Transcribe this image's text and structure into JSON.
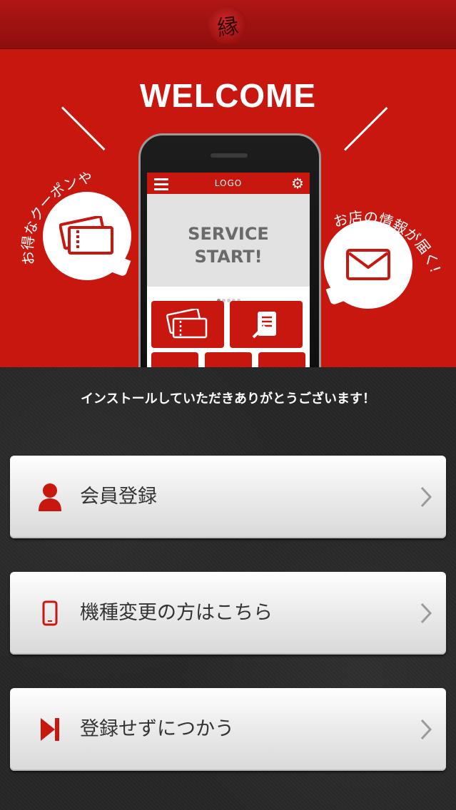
{
  "header": {
    "logo_char": "縁",
    "logo_label": "logo-seal"
  },
  "hero": {
    "title": "WELCOME",
    "left_bubble_caption": "お得なクーポンや",
    "right_bubble_caption": "お店の情報が届く!",
    "phone": {
      "logo": "LOGO",
      "service_text": "SERVICE\nSTART!"
    }
  },
  "thanks": "インストールしていただきありがとうございます！",
  "menu": {
    "register": {
      "label": "会員登録",
      "icon": "person-icon"
    },
    "device_change": {
      "label": "機種変更の方はこちら",
      "icon": "smartphone-icon"
    },
    "skip": {
      "label": "登録せずにつかう",
      "icon": "skip-icon"
    }
  },
  "colors": {
    "brand_red": "#c8170f",
    "icon_red": "#c8170f",
    "bg_dark": "#262626"
  }
}
